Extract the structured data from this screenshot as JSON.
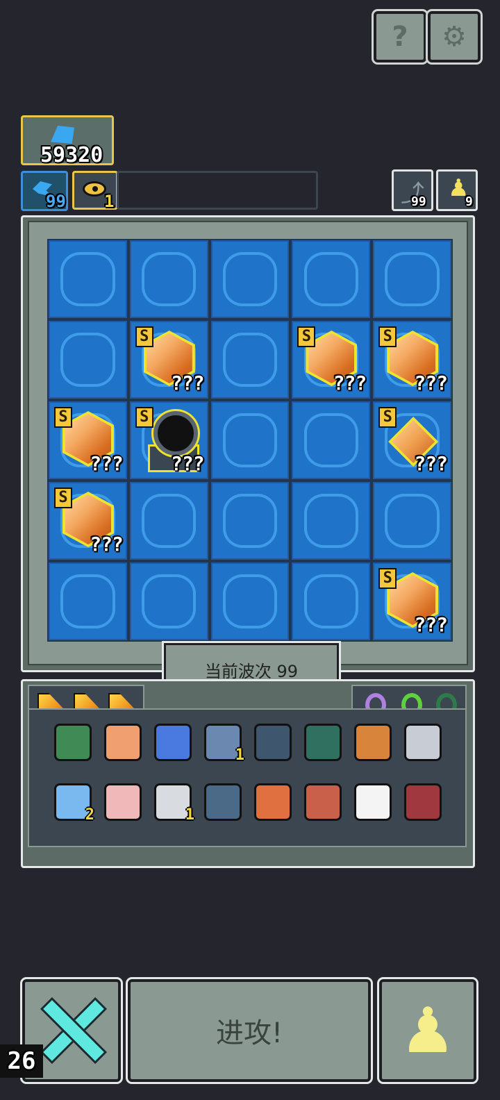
{
  "header": {
    "help_icon": "question-mark-icon",
    "settings_icon": "gear-icon"
  },
  "resources": {
    "gold_value": "59320",
    "gems_value": "99",
    "eye_value": "1",
    "refresh_count": "99",
    "pawn_count": "9"
  },
  "board": {
    "cells": [
      {
        "row": 0,
        "col": 0,
        "item": ""
      },
      {
        "row": 0,
        "col": 1,
        "item": ""
      },
      {
        "row": 0,
        "col": 2,
        "item": ""
      },
      {
        "row": 0,
        "col": 3,
        "item": ""
      },
      {
        "row": 0,
        "col": 4,
        "item": ""
      },
      {
        "row": 1,
        "col": 0,
        "item": ""
      },
      {
        "row": 1,
        "col": 1,
        "item": "crystal",
        "rank": "S",
        "label": "???"
      },
      {
        "row": 1,
        "col": 2,
        "item": ""
      },
      {
        "row": 1,
        "col": 3,
        "item": "crystal",
        "rank": "S",
        "label": "???"
      },
      {
        "row": 1,
        "col": 4,
        "item": "crystal",
        "rank": "S",
        "label": "???"
      },
      {
        "row": 2,
        "col": 0,
        "item": "crystal",
        "rank": "S",
        "label": "???"
      },
      {
        "row": 2,
        "col": 1,
        "item": "cannon",
        "rank": "S",
        "label": "???"
      },
      {
        "row": 2,
        "col": 2,
        "item": ""
      },
      {
        "row": 2,
        "col": 3,
        "item": ""
      },
      {
        "row": 2,
        "col": 4,
        "item": "diamond",
        "rank": "S",
        "label": "???"
      },
      {
        "row": 3,
        "col": 0,
        "item": "crystal",
        "rank": "S",
        "label": "???"
      },
      {
        "row": 3,
        "col": 1,
        "item": ""
      },
      {
        "row": 3,
        "col": 2,
        "item": ""
      },
      {
        "row": 3,
        "col": 3,
        "item": ""
      },
      {
        "row": 3,
        "col": 4,
        "item": ""
      },
      {
        "row": 4,
        "col": 0,
        "item": ""
      },
      {
        "row": 4,
        "col": 1,
        "item": ""
      },
      {
        "row": 4,
        "col": 2,
        "item": ""
      },
      {
        "row": 4,
        "col": 3,
        "item": ""
      },
      {
        "row": 4,
        "col": 4,
        "item": "crystal",
        "rank": "S",
        "label": "???"
      }
    ],
    "wave_label": "当前波次 99"
  },
  "inventory": {
    "wedges": 3,
    "rings": [
      "#b080e0",
      "#60d040",
      "#2f7a4a"
    ],
    "items_row1": [
      {
        "name": "turtle-shell-icon",
        "color": "#3f8a55",
        "count": ""
      },
      {
        "name": "scroll-icon",
        "color": "#f0a070",
        "count": ""
      },
      {
        "name": "goggles-icon",
        "color": "#4a7ae0",
        "count": ""
      },
      {
        "name": "wave-blade-icon",
        "color": "#6a88b0",
        "count": "1"
      },
      {
        "name": "camera-icon",
        "color": "#3e566e",
        "count": ""
      },
      {
        "name": "bench-icon",
        "color": "#2f7060",
        "count": ""
      },
      {
        "name": "painting-icon",
        "color": "#d8843a",
        "count": ""
      },
      {
        "name": "statue-icon",
        "color": "#c8ccd4",
        "count": ""
      }
    ],
    "items_row2": [
      {
        "name": "crystal-ball-icon",
        "color": "#7ab8f0",
        "count": "2"
      },
      {
        "name": "jar-icon",
        "color": "#f0b8b8",
        "count": ""
      },
      {
        "name": "anvil-icon",
        "color": "#d8dce0",
        "count": "1"
      },
      {
        "name": "portal-icon",
        "color": "#4a6a88",
        "count": ""
      },
      {
        "name": "helmet-icon",
        "color": "#e07040",
        "count": ""
      },
      {
        "name": "banner-icon",
        "color": "#c8604a",
        "count": ""
      },
      {
        "name": "vase-icon",
        "color": "#f4f4f4",
        "count": ""
      },
      {
        "name": "bag-icon",
        "color": "#a03840",
        "count": ""
      }
    ]
  },
  "footer": {
    "attack_label": "进攻!",
    "level_badge": "26"
  },
  "colors": {
    "background": "#25252d",
    "panel": "#8a9a92",
    "tile": "#1f74c9",
    "accent": "#f0e230"
  }
}
